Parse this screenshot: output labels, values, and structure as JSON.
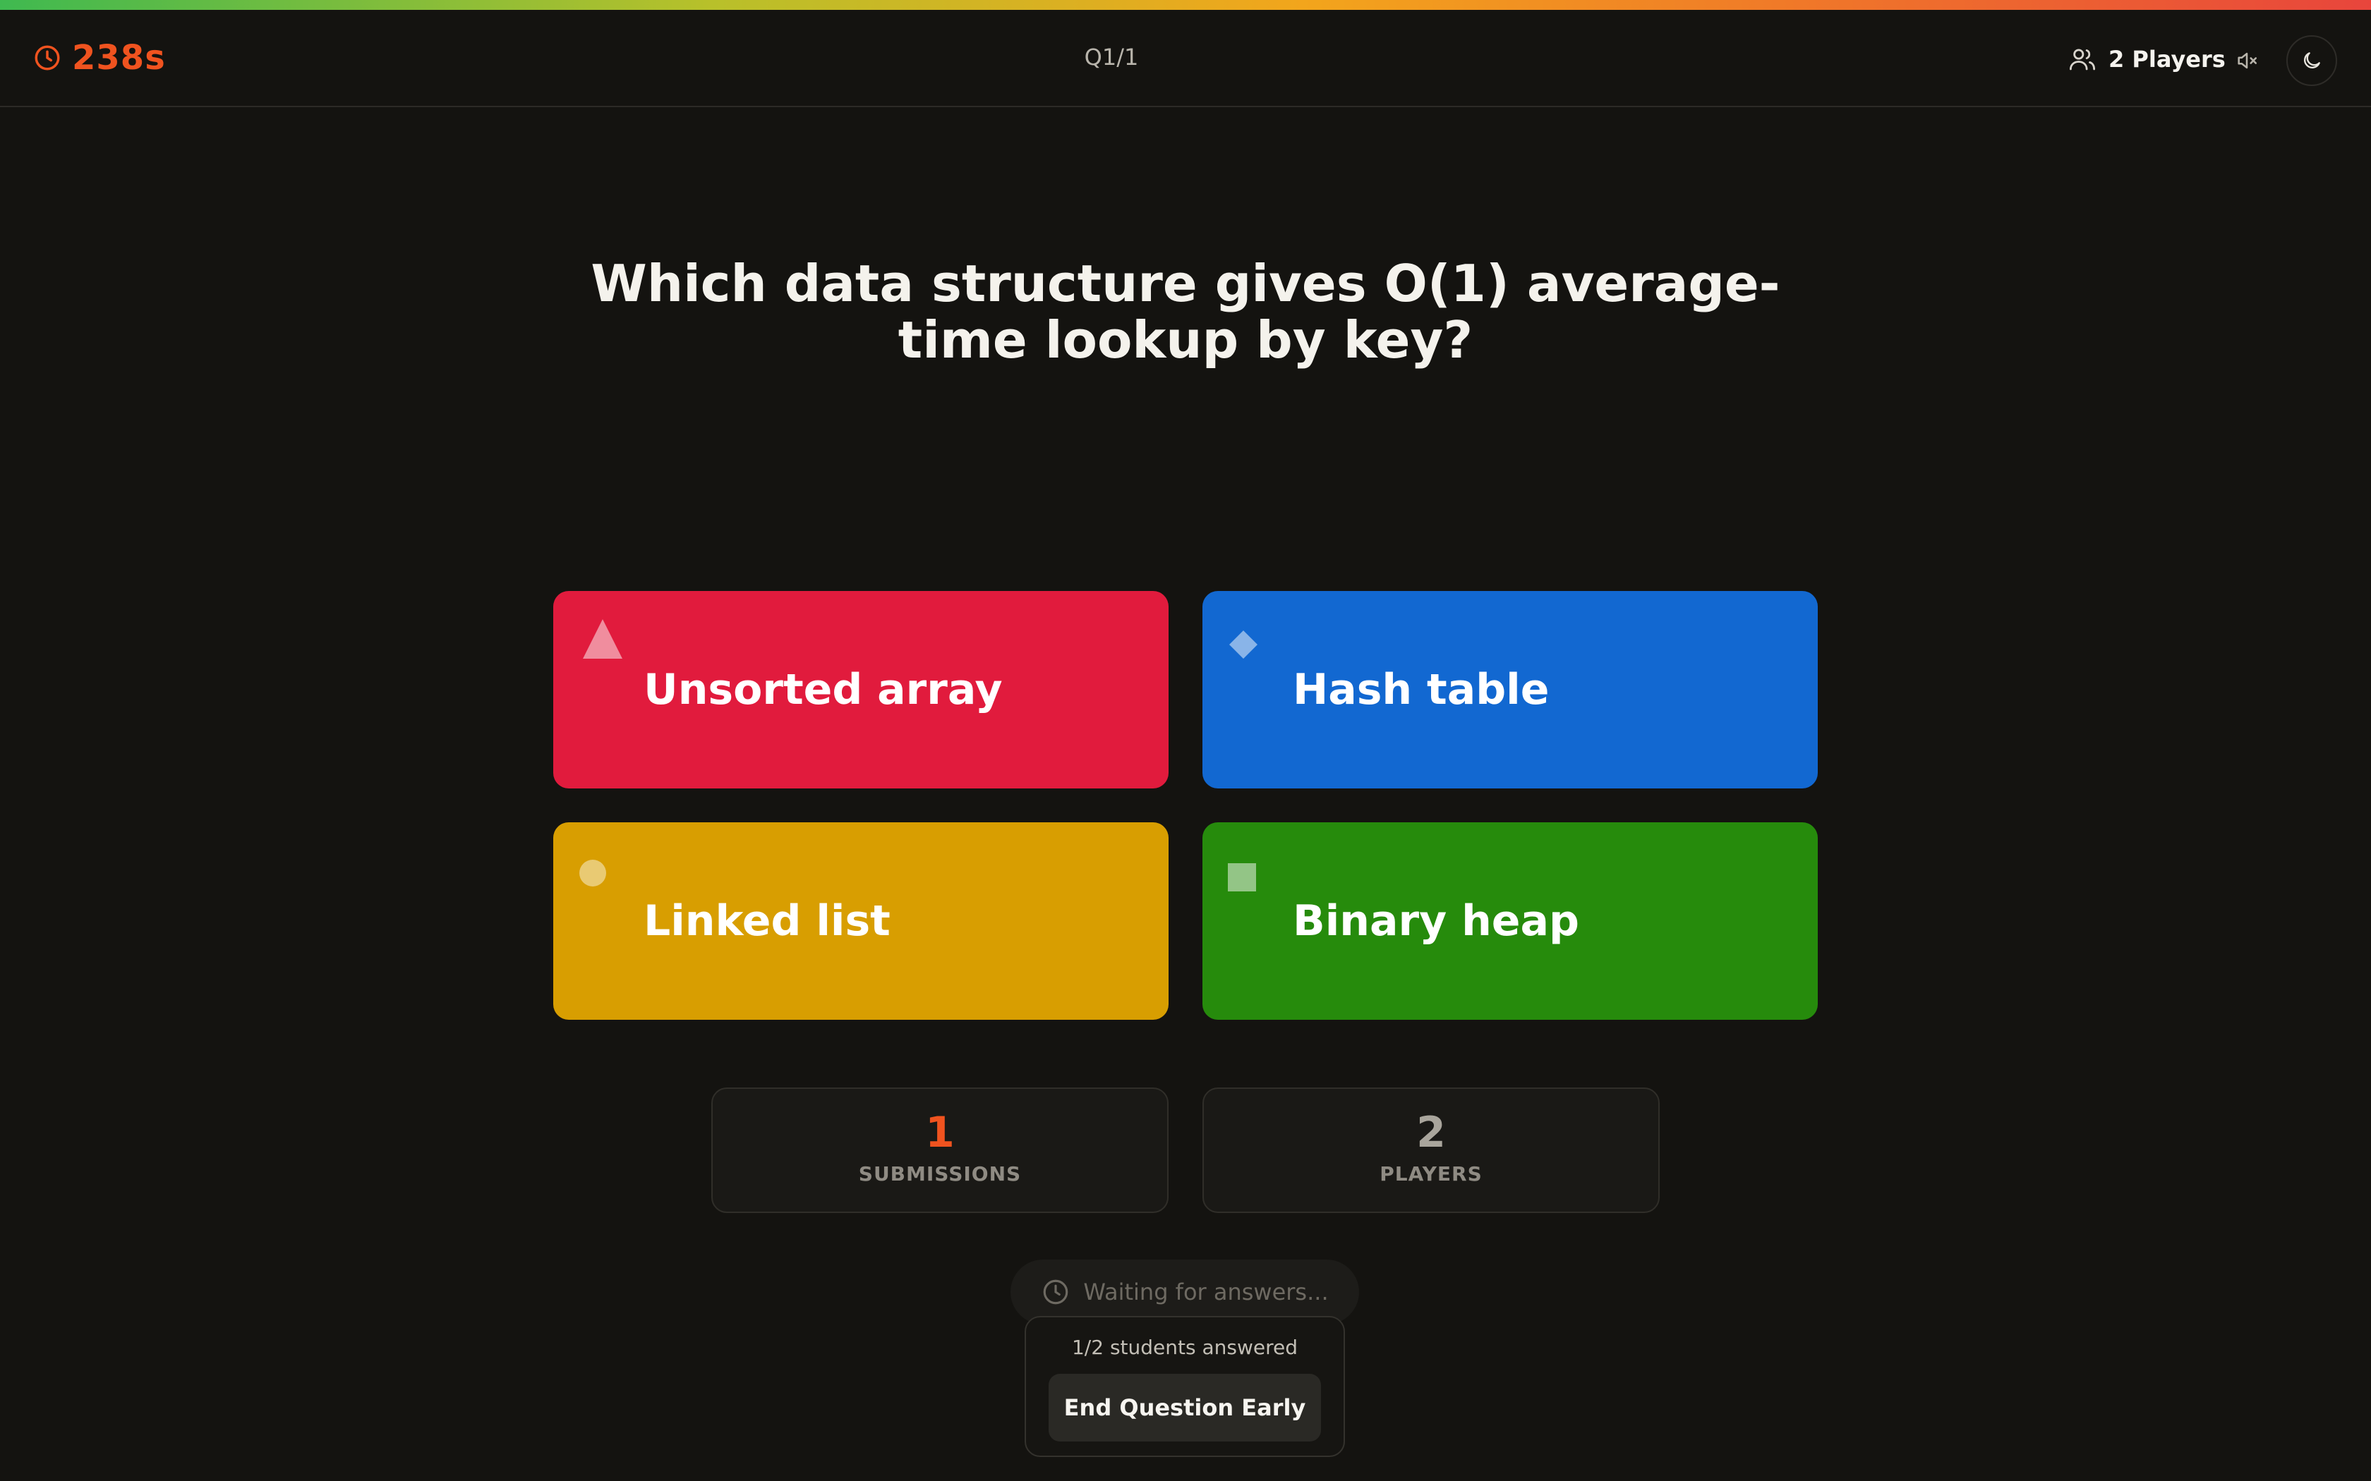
{
  "progress": {
    "remaining_fraction": 1.0
  },
  "header": {
    "timer": "238s",
    "question_counter": "Q1/1",
    "players": "2 Players"
  },
  "question": {
    "text": "Which data structure gives O(1) average-time lookup by key?"
  },
  "answers": [
    {
      "label": "Unsorted array",
      "shape": "triangle",
      "color": "#e11b3d"
    },
    {
      "label": "Hash table",
      "shape": "diamond",
      "color": "#1268d1"
    },
    {
      "label": "Linked list",
      "shape": "circle",
      "color": "#d89e01"
    },
    {
      "label": "Binary heap",
      "shape": "square",
      "color": "#268b0c"
    }
  ],
  "stats": {
    "submissions": {
      "value": "1",
      "label": "SUBMISSIONS"
    },
    "players": {
      "value": "2",
      "label": "PLAYERS"
    }
  },
  "status": {
    "waiting": "Waiting for answers...",
    "answered": "1/2 students answered",
    "end_button": "End Question Early"
  },
  "colors": {
    "accent": "#f0531f",
    "background": "#141310"
  }
}
